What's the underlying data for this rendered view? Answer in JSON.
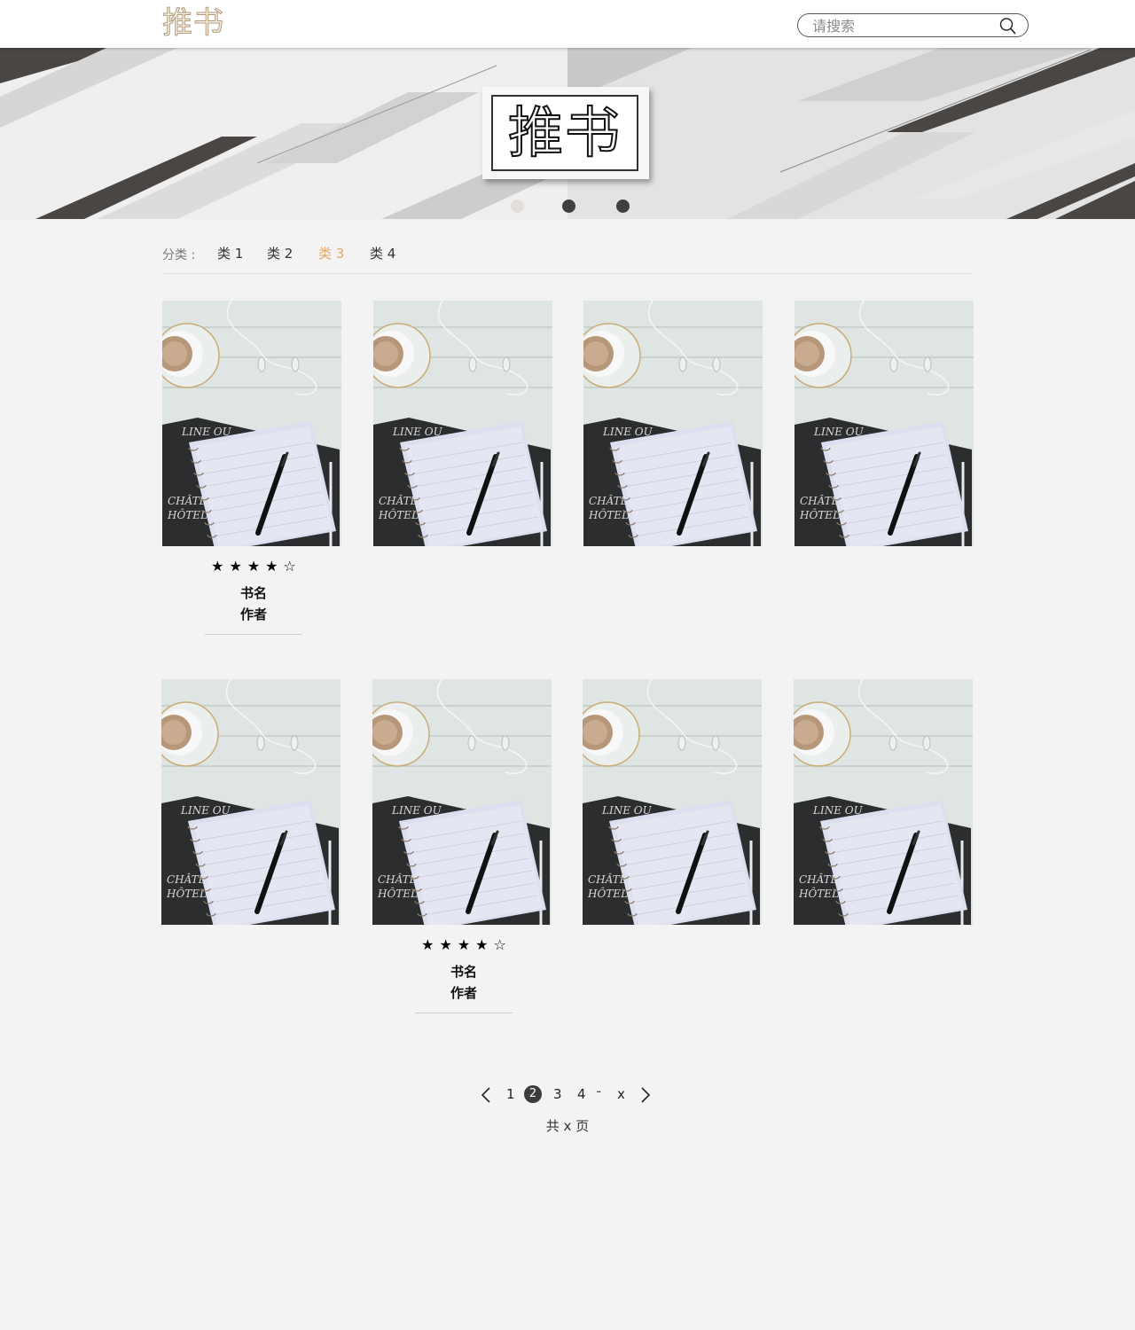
{
  "header": {
    "logo": "推书",
    "search_placeholder": "请搜索"
  },
  "banner": {
    "logo_text": "推书",
    "dot_count": 3,
    "active_dot": 0
  },
  "categories": {
    "label": "分类 :",
    "items": [
      "类 1",
      "类 2",
      "类 3",
      "类 4"
    ],
    "active_index": 2
  },
  "book": {
    "title": "书名",
    "author": "作者",
    "rating": 4,
    "max_rating": 5
  },
  "pagination": {
    "pages": [
      "1",
      "2",
      "3",
      "4"
    ],
    "ellipsis": "···",
    "last": "x",
    "current": "2",
    "total_text": "共 x 页"
  },
  "colors": {
    "accent": "#e6a76b",
    "logo": "#b39a79",
    "dot_active": "#e5dcdc",
    "dot_inactive": "#3f3f3f"
  }
}
